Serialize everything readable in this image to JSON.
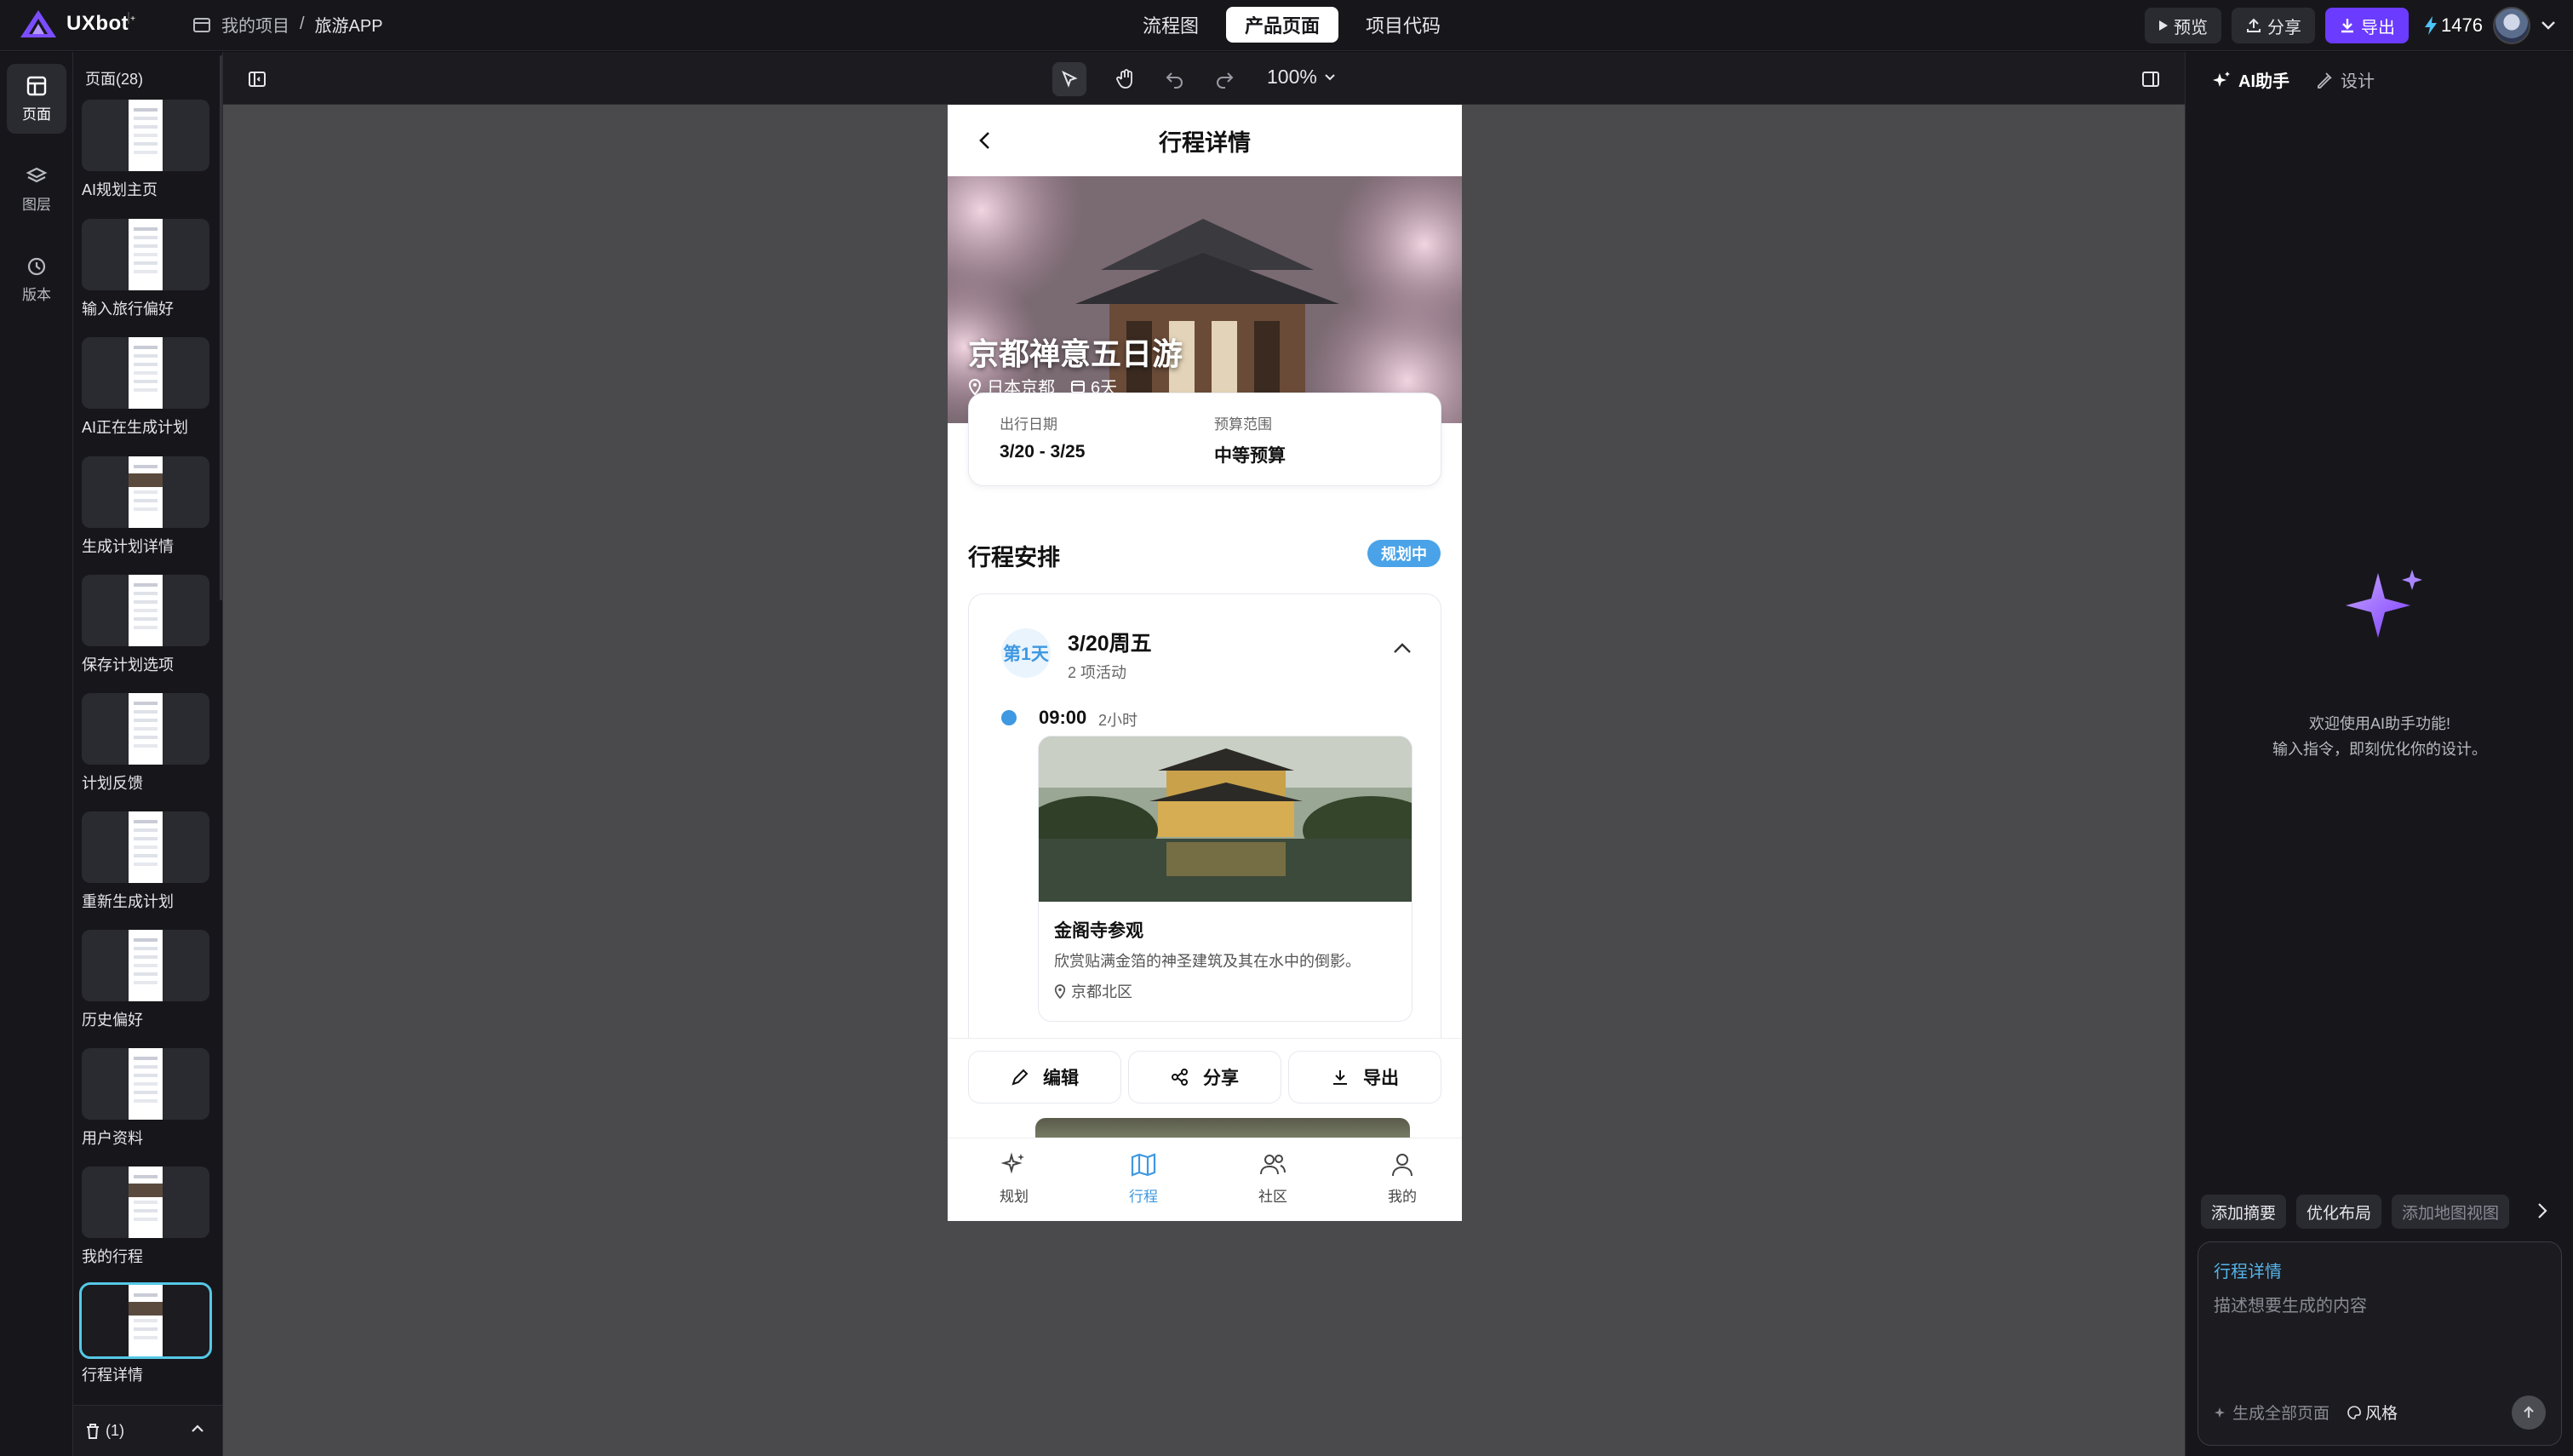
{
  "app": {
    "logo_text": "UXbot",
    "logo_sup": "+"
  },
  "breadcrumb": {
    "parent": "我的项目",
    "separator": "/",
    "current": "旅游APP"
  },
  "mode_tabs": [
    {
      "label": "流程图"
    },
    {
      "label": "产品页面",
      "active": true
    },
    {
      "label": "项目代码"
    }
  ],
  "top_actions": {
    "preview": "预览",
    "share": "分享",
    "export": "导出",
    "credits": "1476"
  },
  "rail": [
    {
      "label": "页面",
      "icon": "pages-icon",
      "active": true
    },
    {
      "label": "图层",
      "icon": "layers-icon"
    },
    {
      "label": "版本",
      "icon": "history-icon"
    }
  ],
  "pages_panel": {
    "title": "页面(28)",
    "items": [
      {
        "label": "AI规划主页"
      },
      {
        "label": "输入旅行偏好"
      },
      {
        "label": "AI正在生成计划"
      },
      {
        "label": "生成计划详情"
      },
      {
        "label": "保存计划选项"
      },
      {
        "label": "计划反馈"
      },
      {
        "label": "重新生成计划"
      },
      {
        "label": "历史偏好"
      },
      {
        "label": "用户资料"
      },
      {
        "label": "我的行程"
      },
      {
        "label": "行程详情",
        "selected": true
      }
    ],
    "trash_label": "(1)"
  },
  "canvas_toolbar": {
    "zoom": "100%"
  },
  "phone": {
    "header_title": "行程详情",
    "hero": {
      "title": "京都禅意五日游",
      "location": "日本京都",
      "days": "6天"
    },
    "info": {
      "date_label": "出行日期",
      "date_value": "3/20 - 3/25",
      "budget_label": "预算范围",
      "budget_value": "中等预算"
    },
    "section_title": "行程安排",
    "status_badge": "规划中",
    "day": {
      "badge": "第1天",
      "date": "3/20周五",
      "count": "2 项活动",
      "activity": {
        "time": "09:00",
        "duration": "2小时",
        "title": "金阁寺参观",
        "desc": "欣赏贴满金箔的神圣建筑及其在水中的倒影。",
        "location": "京都北区"
      }
    },
    "actions": {
      "edit": "编辑",
      "share": "分享",
      "export": "导出"
    },
    "tabs": [
      {
        "label": "规划",
        "icon": "sparkle-icon"
      },
      {
        "label": "行程",
        "icon": "map-icon",
        "active": true
      },
      {
        "label": "社区",
        "icon": "users-icon"
      },
      {
        "label": "我的",
        "icon": "user-icon"
      }
    ]
  },
  "assistant": {
    "tab_ai": "AI助手",
    "tab_design": "设计",
    "welcome_line1": "欢迎使用AI助手功能!",
    "welcome_line2": "输入指令，即刻优化你的设计。",
    "chips": [
      "添加摘要",
      "优化布局",
      "添加地图视图"
    ],
    "context_tag": "行程详情",
    "placeholder": "描述想要生成的内容",
    "generate_all": "生成全部页面",
    "style": "风格"
  },
  "colors": {
    "accent": "#6b3bff",
    "timeline_blue": "#3e98e2",
    "selected_outline": "#56c8e6"
  }
}
